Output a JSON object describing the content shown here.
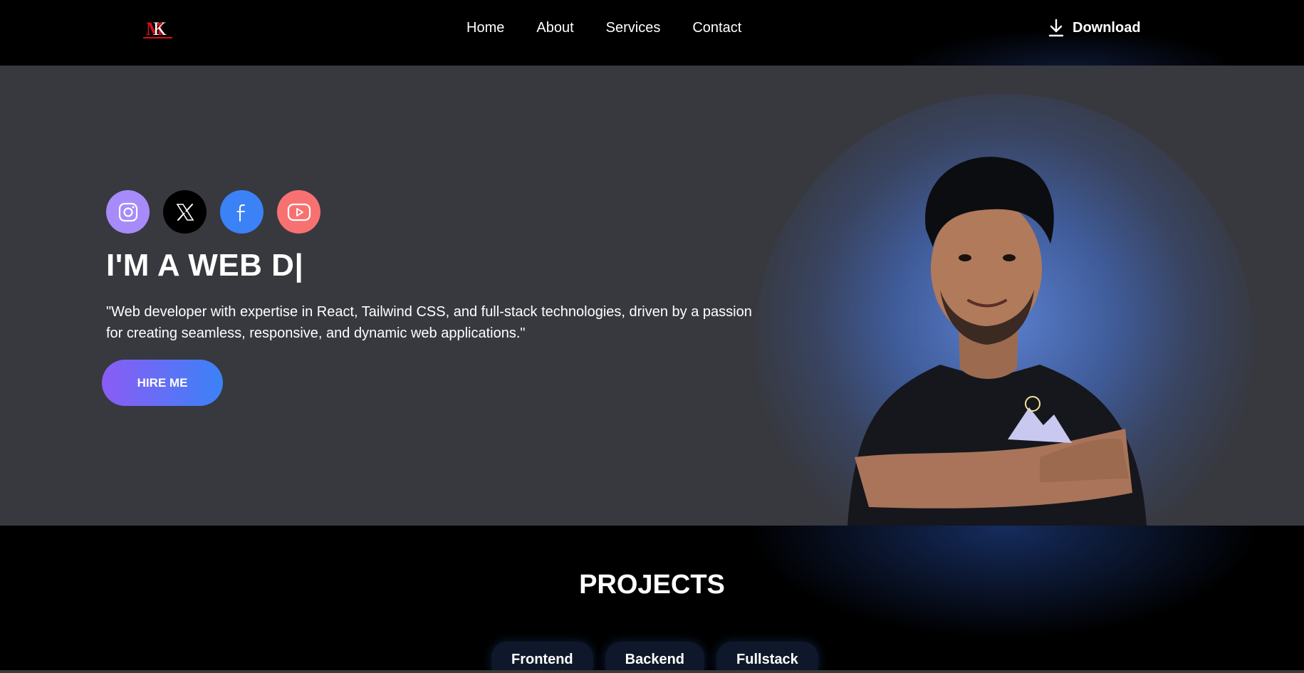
{
  "nav": {
    "logo_text": "MK",
    "links": [
      "Home",
      "About",
      "Services",
      "Contact"
    ],
    "download_label": "Download"
  },
  "hero": {
    "socials": [
      {
        "name": "instagram",
        "icon": "instagram-icon",
        "color": "#a78bfa"
      },
      {
        "name": "x",
        "icon": "x-icon",
        "color": "#000000"
      },
      {
        "name": "facebook",
        "icon": "facebook-icon",
        "color": "#3b82f6"
      },
      {
        "name": "youtube",
        "icon": "youtube-icon",
        "color": "#f87171"
      }
    ],
    "headline": "I'M A WEB D|",
    "bio": "\"Web developer with expertise in React, Tailwind CSS, and full-stack technologies, driven by a passion for creating seamless, responsive, and dynamic web applications.\"",
    "hire_label": "HIRE ME"
  },
  "projects": {
    "title": "PROJECTS",
    "tabs": [
      "Frontend",
      "Backend",
      "Fullstack"
    ]
  },
  "colors": {
    "hero_bg": "#37393f",
    "accent_start": "#8b5cf6",
    "accent_end": "#3b82f6",
    "glow": "#5a7fd0"
  }
}
